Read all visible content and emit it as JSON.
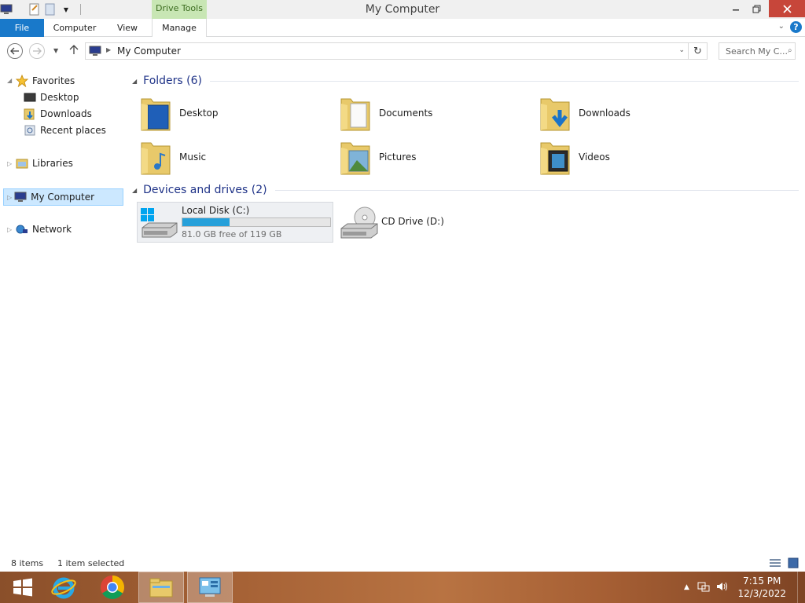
{
  "window": {
    "title": "My Computer",
    "contextual_tab": "Drive Tools"
  },
  "ribbon": {
    "tabs": [
      {
        "label": "File"
      },
      {
        "label": "Computer"
      },
      {
        "label": "View"
      },
      {
        "label": "Manage"
      }
    ]
  },
  "address": {
    "path": "My Computer",
    "search_placeholder": "Search My C..."
  },
  "nav": {
    "favorites": "Favorites",
    "favorite_items": [
      "Desktop",
      "Downloads",
      "Recent places"
    ],
    "libraries": "Libraries",
    "my_computer": "My Computer",
    "network": "Network"
  },
  "folders_group": "Folders (6)",
  "folders": [
    {
      "name": "Desktop",
      "icon": "desktop-folder-icon"
    },
    {
      "name": "Documents",
      "icon": "documents-folder-icon"
    },
    {
      "name": "Downloads",
      "icon": "downloads-folder-icon"
    },
    {
      "name": "Music",
      "icon": "music-folder-icon"
    },
    {
      "name": "Pictures",
      "icon": "pictures-folder-icon"
    },
    {
      "name": "Videos",
      "icon": "videos-folder-icon"
    }
  ],
  "drives_group": "Devices and drives (2)",
  "drives": [
    {
      "name": "Local Disk (C:)",
      "free_text": "81.0 GB free of 119 GB",
      "used_fraction": 0.32
    },
    {
      "name": "CD Drive (D:)"
    }
  ],
  "status": {
    "items": "8 items",
    "selected": "1 item selected"
  },
  "clock": {
    "time": "7:15 PM",
    "date": "12/3/2022"
  },
  "colors": {
    "accent": "#1979ca",
    "drive_tools": "#c8e6b4",
    "close": "#c7463a",
    "bar_fill": "#26a0da",
    "taskbar": "#a66236"
  }
}
